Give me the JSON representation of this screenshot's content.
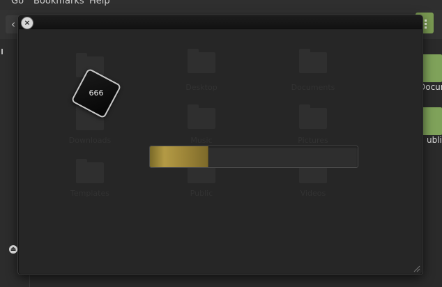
{
  "menubar": {
    "items": [
      "Go",
      "Bookmarks",
      "Help"
    ]
  },
  "toolbar": {
    "back_icon": "chevron-left-icon",
    "view_icon": "grid-view-icon"
  },
  "background_files": [
    {
      "label": "Desktop"
    },
    {
      "label": "Documents"
    },
    {
      "label": "Downloads"
    },
    {
      "label": "Music"
    },
    {
      "label": "Pictures"
    },
    {
      "label": "Public"
    },
    {
      "label": "Templates"
    },
    {
      "label": "Videos"
    }
  ],
  "right_edge_labels": [
    "Documen",
    "ublic"
  ],
  "dialog": {
    "close_glyph": "×",
    "chip_label": "666",
    "progress": 0.28,
    "accent_color": "#b39a45"
  },
  "sidebar": {
    "eject_glyph": "⏏"
  }
}
